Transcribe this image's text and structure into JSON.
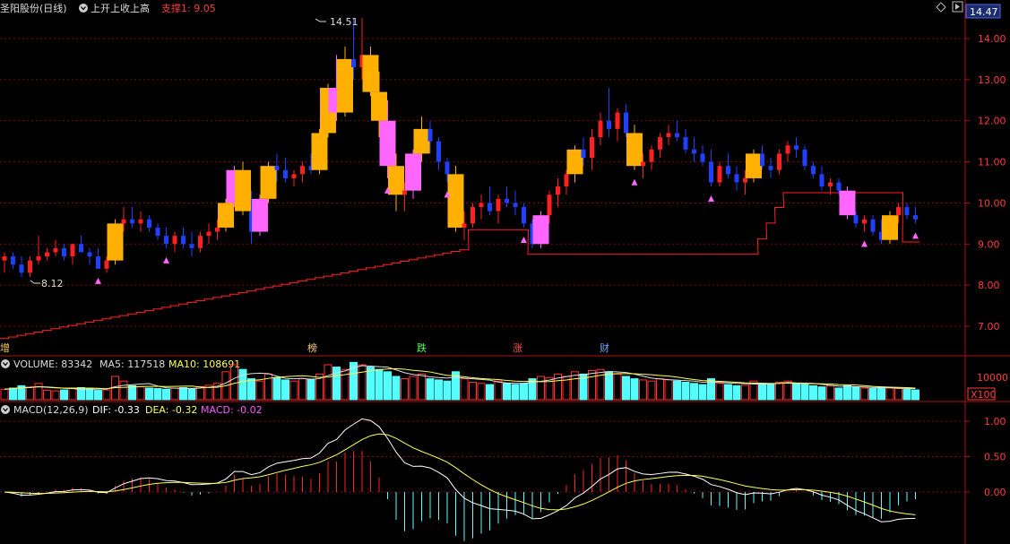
{
  "header": {
    "stock_name": "圣阳股份(日线)",
    "indicator_name": "上开上收上高",
    "support_label": "支撑1: 9.05",
    "current_price_tag": "14.47"
  },
  "price_axis": {
    "ticks": [
      "14.00",
      "13.00",
      "12.00",
      "11.00",
      "10.00",
      "9.00",
      "8.00",
      "7.00"
    ]
  },
  "annotations": {
    "high_label": "14.51",
    "low_label": "8.12"
  },
  "event_markers": {
    "m1": "榜",
    "m2": "跌",
    "m3": "涨",
    "m4": "财",
    "left_edge": "增"
  },
  "volume_panel": {
    "title": "VOLUME: 83342",
    "ma5": "MA5: 117518",
    "ma10": "MA10: 108691",
    "tick": "10000",
    "unit": "X100"
  },
  "macd_panel": {
    "title": "MACD(12,26,9)",
    "dif": "DIF: -0.33",
    "dea": "DEA: -0.32",
    "macd": "MACD: -0.02",
    "ticks": [
      "1.00",
      "0.50",
      "0.00"
    ]
  },
  "colors": {
    "up": "#ff2020",
    "down": "#2040ff",
    "gold": "#ffb000",
    "pink": "#ff66ff",
    "support": "#ff2020",
    "vol_up": "#ff3030",
    "vol_down": "#55ffff",
    "dif": "#ffffff",
    "dea": "#ffff55"
  },
  "chart_data": {
    "type": "candlestick",
    "price_range": [
      6.6,
      14.7
    ],
    "ohlc_approx": [
      [
        8.6,
        8.8,
        8.3,
        8.7
      ],
      [
        8.7,
        8.8,
        8.4,
        8.5
      ],
      [
        8.5,
        8.7,
        8.2,
        8.3
      ],
      [
        8.3,
        8.7,
        8.2,
        8.6
      ],
      [
        8.6,
        9.2,
        8.5,
        8.7
      ],
      [
        8.7,
        8.9,
        8.6,
        8.8
      ],
      [
        8.8,
        9.1,
        8.7,
        8.9
      ],
      [
        8.9,
        9.0,
        8.6,
        8.7
      ],
      [
        8.7,
        9.0,
        8.5,
        9.0
      ],
      [
        9.0,
        9.2,
        8.8,
        8.8
      ],
      [
        8.8,
        8.9,
        8.5,
        8.7
      ],
      [
        8.7,
        8.9,
        8.4,
        8.4
      ],
      [
        8.4,
        8.7,
        8.3,
        8.6
      ],
      [
        8.6,
        9.6,
        8.5,
        9.5
      ],
      [
        9.5,
        9.9,
        9.3,
        9.6
      ],
      [
        9.6,
        9.9,
        9.4,
        9.5
      ],
      [
        9.5,
        9.8,
        9.3,
        9.6
      ],
      [
        9.6,
        9.7,
        9.3,
        9.4
      ],
      [
        9.4,
        9.5,
        9.1,
        9.2
      ],
      [
        9.2,
        9.4,
        8.9,
        9.0
      ],
      [
        9.0,
        9.3,
        8.8,
        9.2
      ],
      [
        9.2,
        9.4,
        8.9,
        9.0
      ],
      [
        9.0,
        9.3,
        8.7,
        8.9
      ],
      [
        8.9,
        9.3,
        8.8,
        9.2
      ],
      [
        9.2,
        9.5,
        9.0,
        9.3
      ],
      [
        9.3,
        9.6,
        9.1,
        9.4
      ],
      [
        9.4,
        10.1,
        9.3,
        10.0
      ],
      [
        10.0,
        10.9,
        9.9,
        10.8
      ],
      [
        10.8,
        11.0,
        9.7,
        9.8
      ],
      [
        9.8,
        10.3,
        9.0,
        9.3
      ],
      [
        9.3,
        10.2,
        9.2,
        10.1
      ],
      [
        10.1,
        11.0,
        10.0,
        10.9
      ],
      [
        10.9,
        11.2,
        10.5,
        10.8
      ],
      [
        10.8,
        11.1,
        10.5,
        10.6
      ],
      [
        10.6,
        10.8,
        10.4,
        10.7
      ],
      [
        10.7,
        11.0,
        10.5,
        10.9
      ],
      [
        10.9,
        11.2,
        10.7,
        10.8
      ],
      [
        10.8,
        11.8,
        10.7,
        11.7
      ],
      [
        11.7,
        12.9,
        11.6,
        12.8
      ],
      [
        12.8,
        13.6,
        12.0,
        12.2
      ],
      [
        12.2,
        13.8,
        12.1,
        13.5
      ],
      [
        13.5,
        14.5,
        13.0,
        13.3
      ],
      [
        13.3,
        14.5,
        13.0,
        13.6
      ],
      [
        13.6,
        13.8,
        12.6,
        12.7
      ],
      [
        12.7,
        13.2,
        11.6,
        12.0
      ],
      [
        12.0,
        12.5,
        10.6,
        10.9
      ],
      [
        10.9,
        11.2,
        9.8,
        10.2
      ],
      [
        10.2,
        10.5,
        9.8,
        10.3
      ],
      [
        10.3,
        11.3,
        10.1,
        11.2
      ],
      [
        11.2,
        12.1,
        11.0,
        11.8
      ],
      [
        11.8,
        12.0,
        11.2,
        11.5
      ],
      [
        11.5,
        11.6,
        10.8,
        11.0
      ],
      [
        11.0,
        11.1,
        10.5,
        10.7
      ],
      [
        10.7,
        10.9,
        9.3,
        9.4
      ],
      [
        9.4,
        9.8,
        9.1,
        9.5
      ],
      [
        9.5,
        10.0,
        9.4,
        9.9
      ],
      [
        9.9,
        10.2,
        9.6,
        10.0
      ],
      [
        10.0,
        10.4,
        9.7,
        9.8
      ],
      [
        9.8,
        10.2,
        9.5,
        10.1
      ],
      [
        10.1,
        10.4,
        9.9,
        10.0
      ],
      [
        10.0,
        10.3,
        9.7,
        9.9
      ],
      [
        9.9,
        10.0,
        9.4,
        9.5
      ],
      [
        9.5,
        9.6,
        8.9,
        9.0
      ],
      [
        9.0,
        9.8,
        8.9,
        9.7
      ],
      [
        9.7,
        10.3,
        9.5,
        10.2
      ],
      [
        10.2,
        10.6,
        9.9,
        10.4
      ],
      [
        10.4,
        10.8,
        10.2,
        10.7
      ],
      [
        10.7,
        11.4,
        10.5,
        11.3
      ],
      [
        11.3,
        11.6,
        10.9,
        11.1
      ],
      [
        11.1,
        11.8,
        10.8,
        11.6
      ],
      [
        11.6,
        12.2,
        11.4,
        12.0
      ],
      [
        12.0,
        12.8,
        11.6,
        11.8
      ],
      [
        11.8,
        12.3,
        11.5,
        12.2
      ],
      [
        12.2,
        12.4,
        11.6,
        11.7
      ],
      [
        11.7,
        11.9,
        10.8,
        10.9
      ],
      [
        10.9,
        11.2,
        10.6,
        11.0
      ],
      [
        11.0,
        11.4,
        10.8,
        11.3
      ],
      [
        11.3,
        11.7,
        11.1,
        11.6
      ],
      [
        11.6,
        11.9,
        11.4,
        11.7
      ],
      [
        11.7,
        12.0,
        11.5,
        11.6
      ],
      [
        11.6,
        11.8,
        11.2,
        11.3
      ],
      [
        11.3,
        11.6,
        11.0,
        11.2
      ],
      [
        11.2,
        11.4,
        10.9,
        11.0
      ],
      [
        11.0,
        11.3,
        10.4,
        10.5
      ],
      [
        10.5,
        11.0,
        10.4,
        10.9
      ],
      [
        10.9,
        11.2,
        10.6,
        10.7
      ],
      [
        10.7,
        10.9,
        10.3,
        10.5
      ],
      [
        10.5,
        10.8,
        10.2,
        10.6
      ],
      [
        10.6,
        11.3,
        10.5,
        11.2
      ],
      [
        11.2,
        11.4,
        10.8,
        10.9
      ],
      [
        10.9,
        11.1,
        10.6,
        10.8
      ],
      [
        10.8,
        11.3,
        10.7,
        11.2
      ],
      [
        11.2,
        11.5,
        11.0,
        11.4
      ],
      [
        11.4,
        11.6,
        11.1,
        11.3
      ],
      [
        11.3,
        11.4,
        10.8,
        10.9
      ],
      [
        10.9,
        11.0,
        10.6,
        10.7
      ],
      [
        10.7,
        10.9,
        10.3,
        10.4
      ],
      [
        10.4,
        10.6,
        10.2,
        10.5
      ],
      [
        10.5,
        10.6,
        10.2,
        10.3
      ],
      [
        10.3,
        10.4,
        9.6,
        9.7
      ],
      [
        9.7,
        9.8,
        9.4,
        9.5
      ],
      [
        9.5,
        9.7,
        9.3,
        9.6
      ],
      [
        9.6,
        9.7,
        9.2,
        9.3
      ],
      [
        9.3,
        9.6,
        9.0,
        9.1
      ],
      [
        9.1,
        9.8,
        9.0,
        9.7
      ],
      [
        9.7,
        10.0,
        9.5,
        9.9
      ],
      [
        9.9,
        10.0,
        9.6,
        9.7
      ],
      [
        9.7,
        9.9,
        9.5,
        9.6
      ]
    ],
    "support_line": {
      "name": "支撑1",
      "start": 6.7,
      "end": 9.05
    },
    "volume": {
      "values_x100": [
        450,
        500,
        600,
        550,
        700,
        400,
        380,
        420,
        480,
        520,
        460,
        400,
        420,
        1000,
        800,
        600,
        550,
        500,
        480,
        450,
        500,
        520,
        480,
        560,
        620,
        700,
        1200,
        1500,
        1300,
        900,
        800,
        1100,
        950,
        850,
        800,
        900,
        880,
        1100,
        1500,
        1400,
        1300,
        1600,
        1500,
        1400,
        1300,
        1200,
        1000,
        900,
        1000,
        1100,
        900,
        850,
        800,
        1200,
        900,
        750,
        700,
        650,
        800,
        700,
        650,
        700,
        900,
        1000,
        950,
        1100,
        1000,
        1200,
        1100,
        1250,
        1300,
        1200,
        1100,
        1000,
        900,
        850,
        800,
        900,
        850,
        800,
        750,
        700,
        650,
        900,
        700,
        650,
        600,
        620,
        800,
        700,
        650,
        750,
        800,
        700,
        650,
        600,
        550,
        600,
        500,
        600,
        550,
        500,
        480,
        520,
        500,
        480,
        450,
        420
      ]
    },
    "macd": {
      "dif_range": [
        -0.6,
        1.2
      ],
      "ticks": [
        1.0,
        0.5,
        0.0
      ],
      "last": {
        "dif": -0.33,
        "dea": -0.32,
        "macd": -0.02
      }
    }
  }
}
